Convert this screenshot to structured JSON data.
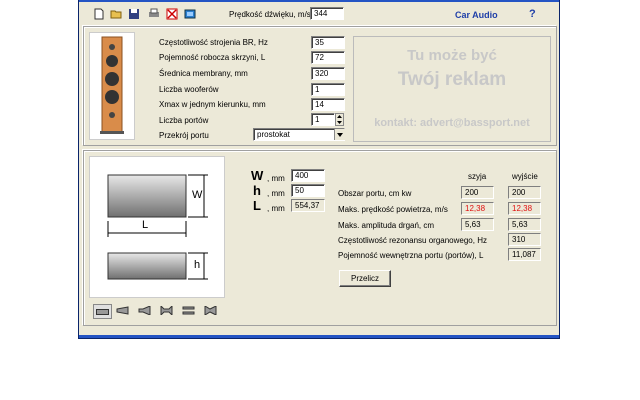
{
  "header": {
    "speed_label": "Prędkość dźwięku, m/s",
    "speed_value": "344",
    "brand": "Car Audio",
    "help": "?"
  },
  "params": [
    {
      "label": "Częstotliwość strojenia BR, Hz",
      "value": "35"
    },
    {
      "label": "Pojemność robocza skrzyni, L",
      "value": "72"
    },
    {
      "label": "Średnica membrany, mm",
      "value": "320"
    },
    {
      "label": "Liczba wooferów",
      "value": "1"
    },
    {
      "label": "Xmax w jednym kierunku, mm",
      "value": "14"
    },
    {
      "label": "Liczba portów",
      "value": "1"
    }
  ],
  "port_section": {
    "label": "Przekrój portu",
    "selected": "prostokat"
  },
  "ad": {
    "line1": "Tu może być",
    "line2": "Twój reklam",
    "contact": "kontakt: advert@bassport.net"
  },
  "dims": {
    "w_letter": "W",
    "w_unit": ", mm",
    "w_value": "400",
    "h_letter": "h",
    "h_unit": ", mm",
    "h_value": "50",
    "l_letter": "L",
    "l_unit": ", mm",
    "l_value": "554,37",
    "diagram_w": "W",
    "diagram_l": "L",
    "diagram_h": "h"
  },
  "results": {
    "col_neck": "szyja",
    "col_exit": "wyjście",
    "rows": [
      {
        "label": "Obszar portu, cm kw",
        "neck": "200",
        "exit": "200",
        "red": false
      },
      {
        "label": "Maks. prędkość powietrza, m/s",
        "neck": "12,38",
        "exit": "12,38",
        "red": true
      },
      {
        "label": "Maks. amplituda drgań, cm",
        "neck": "5,63",
        "exit": "5,63",
        "red": false
      },
      {
        "label": "Częstotliwość rezonansu organowego, Hz",
        "neck": "",
        "exit": "310",
        "red": false
      },
      {
        "label": "Pojemność wewnętrzna portu (portów), L",
        "neck": "",
        "exit": "11,087",
        "red": false
      }
    ]
  },
  "calc_button": "Przelicz",
  "colors": {
    "accent": "#1f3fa8",
    "red": "#e01010",
    "title_blue": "#2454c4"
  }
}
